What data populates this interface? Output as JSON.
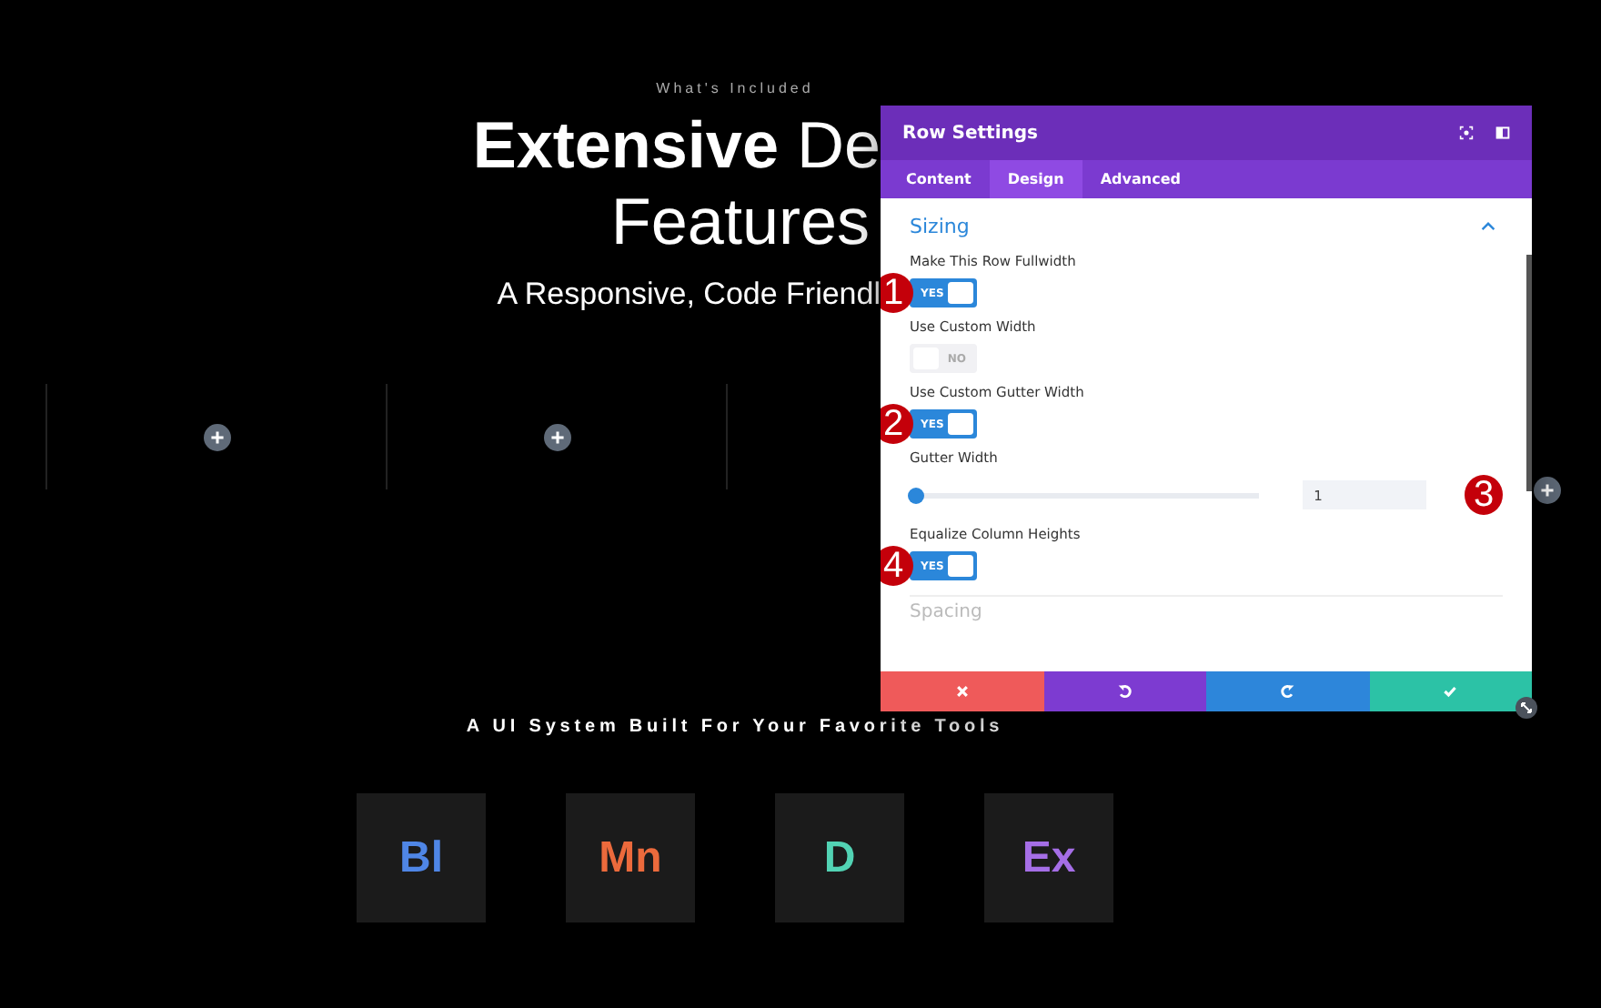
{
  "page": {
    "eyebrow": "What's Included",
    "headline_bold": "Extensive",
    "headline_rest": "De",
    "headline_line2": "Features",
    "subtitle": "A Responsive, Code Friendl",
    "tools_heading": "A UI System Built For Your Favorite Tools",
    "tools": [
      {
        "label": "Bl",
        "color": "#4f86e6"
      },
      {
        "label": "Mn",
        "color": "#ec6a3c"
      },
      {
        "label": "D",
        "color": "#52d3b4"
      },
      {
        "label": "Ex",
        "color": "#a56ee6"
      }
    ]
  },
  "modal": {
    "title": "Row Settings",
    "tabs": [
      {
        "label": "Content",
        "selected": false
      },
      {
        "label": "Design",
        "selected": true
      },
      {
        "label": "Advanced",
        "selected": false
      }
    ],
    "section": {
      "title": "Sizing",
      "expanded": true
    },
    "fields": [
      {
        "kind": "toggle",
        "label": "Make This Row Fullwidth",
        "on": true,
        "text": "YES",
        "marker": "1"
      },
      {
        "kind": "toggle",
        "label": "Use Custom Width",
        "on": false,
        "text": "NO"
      },
      {
        "kind": "toggle",
        "label": "Use Custom Gutter Width",
        "on": true,
        "text": "YES",
        "marker": "2"
      },
      {
        "kind": "slider",
        "label": "Gutter Width",
        "level": 0,
        "value": "1",
        "marker": "3"
      },
      {
        "kind": "toggle",
        "label": "Equalize Column Heights",
        "on": true,
        "text": "YES",
        "marker": "4"
      }
    ],
    "next_section": "Spacing",
    "footer": [
      {
        "kind": "cancel",
        "color": "#ef5a5a"
      },
      {
        "kind": "undo",
        "color": "#7d3bd1"
      },
      {
        "kind": "redo",
        "color": "#2d86da"
      },
      {
        "kind": "save",
        "color": "#2cc2a6"
      }
    ]
  }
}
